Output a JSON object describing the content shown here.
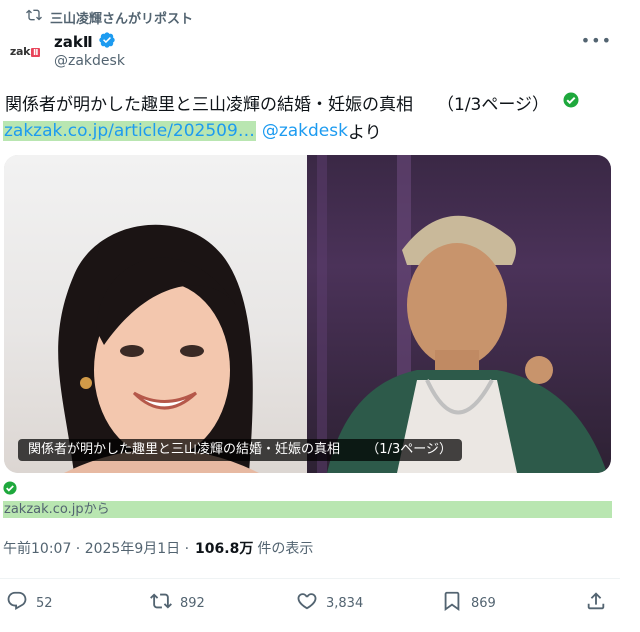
{
  "repost": {
    "label": "三山凌輝さんがリポスト"
  },
  "author": {
    "display_name": "zakⅡ",
    "handle": "@zakdesk",
    "avatar_text": "zak",
    "avatar_badge": "Ⅱ"
  },
  "tweet": {
    "title": "関係者が明かした趣里と三山凌輝の結婚・妊娠の真相",
    "page": "（1/3ページ）",
    "link": "zakzak.co.jp/article/202509…",
    "mention": "@zakdesk",
    "mention_suffix": "より"
  },
  "card": {
    "caption_title": "関係者が明かした趣里と三山凌輝の結婚・妊娠の真相",
    "caption_page": "（1/3ページ）",
    "source": "zakzak.co.jpから"
  },
  "meta": {
    "time": "午前10:07 · 2025年9月1日 · ",
    "views": "106.8万",
    "views_suffix": "件の表示"
  },
  "actions": {
    "replies": "52",
    "reposts": "892",
    "likes": "3,834",
    "bookmarks": "869"
  },
  "colors": {
    "accent": "#1d9bf0",
    "highlight": "#b9e6b1",
    "check_green": "#1ea83c",
    "muted": "#536471"
  }
}
